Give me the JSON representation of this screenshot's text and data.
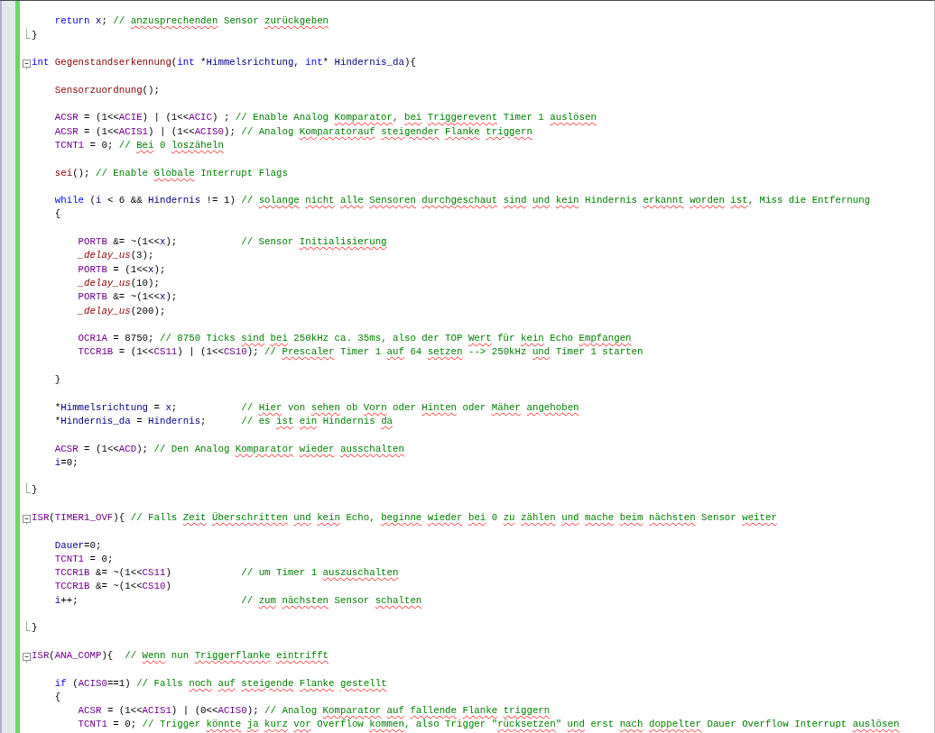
{
  "editor": {
    "lines": [
      {
        "kind": "body"
      },
      {
        "kind": "body",
        "tokens": [
          {
            "t": "    return",
            "kind": "kw"
          },
          {
            "t": " x",
            "kind": "var"
          },
          {
            "t": "; ",
            "kind": "plain"
          },
          {
            "t": "// ",
            "kind": "cm"
          },
          {
            "t": "anzusprechenden",
            "kind": "typo"
          },
          {
            "t": " Sensor ",
            "kind": "cm"
          },
          {
            "t": "zurückgeben",
            "kind": "typo"
          }
        ]
      },
      {
        "kind": "end",
        "tokens": [
          {
            "t": "}",
            "kind": "plain"
          }
        ]
      },
      {
        "kind": "free"
      },
      {
        "kind": "start",
        "tokens": [
          {
            "t": "int ",
            "kind": "kw"
          },
          {
            "t": "Gegenstandserkennung",
            "kind": "fn"
          },
          {
            "t": "(",
            "kind": "plain"
          },
          {
            "t": "int",
            "kind": "kw"
          },
          {
            "t": " *",
            "kind": "plain"
          },
          {
            "t": "Himmelsrichtung",
            "kind": "var"
          },
          {
            "t": ", ",
            "kind": "plain"
          },
          {
            "t": "int",
            "kind": "kw"
          },
          {
            "t": "* ",
            "kind": "plain"
          },
          {
            "t": "Hindernis_da",
            "kind": "var"
          },
          {
            "t": "){",
            "kind": "plain"
          }
        ]
      },
      {
        "kind": "body"
      },
      {
        "kind": "body",
        "tokens": [
          {
            "t": "    Sensorzuordnung",
            "kind": "fn"
          },
          {
            "t": "();",
            "kind": "plain"
          }
        ]
      },
      {
        "kind": "body"
      },
      {
        "kind": "body",
        "tokens": [
          {
            "t": "    ACSR",
            "kind": "macro"
          },
          {
            "t": " = (1<<",
            "kind": "plain"
          },
          {
            "t": "ACIE",
            "kind": "macro"
          },
          {
            "t": ") | (1<<",
            "kind": "plain"
          },
          {
            "t": "ACIC",
            "kind": "macro"
          },
          {
            "t": ") ; ",
            "kind": "plain"
          },
          {
            "t": "// Enable Analog ",
            "kind": "cm"
          },
          {
            "t": "Komparator",
            "kind": "typo"
          },
          {
            "t": ", ",
            "kind": "cm"
          },
          {
            "t": "bei ",
            "kind": "typo"
          },
          {
            "t": "Triggerevent",
            "kind": "typo"
          },
          {
            "t": " Timer 1 ",
            "kind": "cm"
          },
          {
            "t": "auslösen",
            "kind": "typo"
          }
        ]
      },
      {
        "kind": "body",
        "tokens": [
          {
            "t": "    ACSR",
            "kind": "macro"
          },
          {
            "t": " = (1<<",
            "kind": "plain"
          },
          {
            "t": "ACIS1",
            "kind": "macro"
          },
          {
            "t": ") | (1<<",
            "kind": "plain"
          },
          {
            "t": "ACIS0",
            "kind": "macro"
          },
          {
            "t": "); ",
            "kind": "plain"
          },
          {
            "t": "// Analog ",
            "kind": "cm"
          },
          {
            "t": "Komparatorauf ",
            "kind": "typo"
          },
          {
            "t": "steigender ",
            "kind": "typo"
          },
          {
            "t": "Flanke ",
            "kind": "typo"
          },
          {
            "t": "triggern",
            "kind": "typo"
          }
        ]
      },
      {
        "kind": "body",
        "tokens": [
          {
            "t": "    TCNT1",
            "kind": "macro"
          },
          {
            "t": " = 0; ",
            "kind": "plain"
          },
          {
            "t": "// ",
            "kind": "cm"
          },
          {
            "t": "Bei",
            "kind": "typo"
          },
          {
            "t": " 0 ",
            "kind": "cm"
          },
          {
            "t": "loszäheln",
            "kind": "typo"
          }
        ]
      },
      {
        "kind": "body"
      },
      {
        "kind": "body",
        "tokens": [
          {
            "t": "    sei",
            "kind": "fn"
          },
          {
            "t": "(); ",
            "kind": "plain"
          },
          {
            "t": "// Enable ",
            "kind": "cm"
          },
          {
            "t": "Globale",
            "kind": "typo"
          },
          {
            "t": " Interrupt Flags",
            "kind": "cm"
          }
        ]
      },
      {
        "kind": "body"
      },
      {
        "kind": "body",
        "tokens": [
          {
            "t": "    while",
            "kind": "kw"
          },
          {
            "t": " (",
            "kind": "plain"
          },
          {
            "t": "i",
            "kind": "var"
          },
          {
            "t": " < 6 && ",
            "kind": "plain"
          },
          {
            "t": "Hindernis",
            "kind": "var"
          },
          {
            "t": " != 1) ",
            "kind": "plain"
          },
          {
            "t": "// ",
            "kind": "cm"
          },
          {
            "t": "solange ",
            "kind": "typo"
          },
          {
            "t": "nicht ",
            "kind": "typo"
          },
          {
            "t": "alle ",
            "kind": "typo"
          },
          {
            "t": "Sensoren ",
            "kind": "typo"
          },
          {
            "t": "durchgeschaut ",
            "kind": "typo"
          },
          {
            "t": "sind ",
            "kind": "typo"
          },
          {
            "t": "und ",
            "kind": "typo"
          },
          {
            "t": "kein",
            "kind": "typo"
          },
          {
            "t": " Hindernis ",
            "kind": "cm"
          },
          {
            "t": "erkannt ",
            "kind": "typo"
          },
          {
            "t": "worden ",
            "kind": "typo"
          },
          {
            "t": "ist",
            "kind": "typo"
          },
          {
            "t": ", Miss die Entfernung",
            "kind": "cm"
          }
        ]
      },
      {
        "kind": "body",
        "tokens": [
          {
            "t": "    {",
            "kind": "plain"
          }
        ]
      },
      {
        "kind": "body"
      },
      {
        "kind": "body",
        "tokens": [
          {
            "t": "        PORTB",
            "kind": "macro"
          },
          {
            "t": " &= ~(1<<",
            "kind": "plain"
          },
          {
            "t": "x",
            "kind": "var"
          },
          {
            "t": ");           ",
            "kind": "plain"
          },
          {
            "t": "// Sensor ",
            "kind": "cm"
          },
          {
            "t": "Initialisierung",
            "kind": "typo"
          }
        ]
      },
      {
        "kind": "body",
        "tokens": [
          {
            "t": "        _delay_us",
            "kind": "fni"
          },
          {
            "t": "(3);",
            "kind": "plain"
          }
        ]
      },
      {
        "kind": "body",
        "tokens": [
          {
            "t": "        PORTB",
            "kind": "macro"
          },
          {
            "t": " = (1<<",
            "kind": "plain"
          },
          {
            "t": "x",
            "kind": "var"
          },
          {
            "t": ");",
            "kind": "plain"
          }
        ]
      },
      {
        "kind": "body",
        "tokens": [
          {
            "t": "        _delay_us",
            "kind": "fni"
          },
          {
            "t": "(10);",
            "kind": "plain"
          }
        ]
      },
      {
        "kind": "body",
        "tokens": [
          {
            "t": "        PORTB",
            "kind": "macro"
          },
          {
            "t": " &= ~(1<<",
            "kind": "plain"
          },
          {
            "t": "x",
            "kind": "var"
          },
          {
            "t": ");",
            "kind": "plain"
          }
        ]
      },
      {
        "kind": "body",
        "tokens": [
          {
            "t": "        _delay_us",
            "kind": "fni"
          },
          {
            "t": "(200);",
            "kind": "plain"
          }
        ]
      },
      {
        "kind": "body"
      },
      {
        "kind": "body",
        "tokens": [
          {
            "t": "        OCR1A",
            "kind": "macro"
          },
          {
            "t": " = 8750; ",
            "kind": "plain"
          },
          {
            "t": "// 8750 Ticks ",
            "kind": "cm"
          },
          {
            "t": "sind ",
            "kind": "typo"
          },
          {
            "t": "bei",
            "kind": "typo"
          },
          {
            "t": " 250kHz ca. 35ms, also der TOP ",
            "kind": "cm"
          },
          {
            "t": "Wert",
            "kind": "typo"
          },
          {
            "t": " für ",
            "kind": "cm"
          },
          {
            "t": "kein",
            "kind": "typo"
          },
          {
            "t": " Echo ",
            "kind": "cm"
          },
          {
            "t": "Empfangen",
            "kind": "typo"
          }
        ]
      },
      {
        "kind": "body",
        "tokens": [
          {
            "t": "        TCCR1B",
            "kind": "macro"
          },
          {
            "t": " = (1<<",
            "kind": "plain"
          },
          {
            "t": "CS11",
            "kind": "macro"
          },
          {
            "t": ") | (1<<",
            "kind": "plain"
          },
          {
            "t": "CS10",
            "kind": "macro"
          },
          {
            "t": "); ",
            "kind": "plain"
          },
          {
            "t": "// ",
            "kind": "cm"
          },
          {
            "t": "Prescaler",
            "kind": "typo"
          },
          {
            "t": " Timer 1 ",
            "kind": "cm"
          },
          {
            "t": "auf",
            "kind": "typo"
          },
          {
            "t": " 64 ",
            "kind": "cm"
          },
          {
            "t": "setzen",
            "kind": "typo"
          },
          {
            "t": " --> 250kHz ",
            "kind": "cm"
          },
          {
            "t": "und",
            "kind": "typo"
          },
          {
            "t": " Timer 1 starten",
            "kind": "cm"
          }
        ]
      },
      {
        "kind": "body"
      },
      {
        "kind": "body",
        "tokens": [
          {
            "t": "    }",
            "kind": "plain"
          }
        ]
      },
      {
        "kind": "body"
      },
      {
        "kind": "body",
        "tokens": [
          {
            "t": "    *",
            "kind": "plain"
          },
          {
            "t": "Himmelsrichtung",
            "kind": "var"
          },
          {
            "t": " = ",
            "kind": "plain"
          },
          {
            "t": "x",
            "kind": "var"
          },
          {
            "t": ";           ",
            "kind": "plain"
          },
          {
            "t": "// ",
            "kind": "cm"
          },
          {
            "t": "Hier",
            "kind": "typo"
          },
          {
            "t": " von ",
            "kind": "cm"
          },
          {
            "t": "sehen",
            "kind": "typo"
          },
          {
            "t": " ob ",
            "kind": "cm"
          },
          {
            "t": "Vorn",
            "kind": "typo"
          },
          {
            "t": " oder ",
            "kind": "cm"
          },
          {
            "t": "Hinten",
            "kind": "typo"
          },
          {
            "t": " oder ",
            "kind": "cm"
          },
          {
            "t": "Mäher ",
            "kind": "typo"
          },
          {
            "t": "angehoben",
            "kind": "typo"
          }
        ]
      },
      {
        "kind": "body",
        "tokens": [
          {
            "t": "    *",
            "kind": "plain"
          },
          {
            "t": "Hindernis_da",
            "kind": "var"
          },
          {
            "t": " = ",
            "kind": "plain"
          },
          {
            "t": "Hindernis",
            "kind": "var"
          },
          {
            "t": ";      ",
            "kind": "plain"
          },
          {
            "t": "// es ",
            "kind": "cm"
          },
          {
            "t": "ist ",
            "kind": "typo"
          },
          {
            "t": "ein",
            "kind": "typo"
          },
          {
            "t": " Hindernis ",
            "kind": "cm"
          },
          {
            "t": "da",
            "kind": "typo"
          }
        ]
      },
      {
        "kind": "body"
      },
      {
        "kind": "body",
        "tokens": [
          {
            "t": "    ACSR",
            "kind": "macro"
          },
          {
            "t": " = (1<<",
            "kind": "plain"
          },
          {
            "t": "ACD",
            "kind": "macro"
          },
          {
            "t": "); ",
            "kind": "plain"
          },
          {
            "t": "// Den Analog ",
            "kind": "cm"
          },
          {
            "t": "Komparator ",
            "kind": "typo"
          },
          {
            "t": "wieder ",
            "kind": "typo"
          },
          {
            "t": "ausschalten",
            "kind": "typo"
          }
        ]
      },
      {
        "kind": "body",
        "tokens": [
          {
            "t": "    i",
            "kind": "var"
          },
          {
            "t": "=0;",
            "kind": "plain"
          }
        ]
      },
      {
        "kind": "body"
      },
      {
        "kind": "end",
        "tokens": [
          {
            "t": "}",
            "kind": "plain"
          }
        ]
      },
      {
        "kind": "free"
      },
      {
        "kind": "start",
        "tokens": [
          {
            "t": "ISR",
            "kind": "macro"
          },
          {
            "t": "(",
            "kind": "plain"
          },
          {
            "t": "TIMER1_OVF",
            "kind": "macro"
          },
          {
            "t": "){ ",
            "kind": "plain"
          },
          {
            "t": "// Falls ",
            "kind": "cm"
          },
          {
            "t": "Zeit ",
            "kind": "typo"
          },
          {
            "t": "Überschritten ",
            "kind": "typo"
          },
          {
            "t": "und ",
            "kind": "typo"
          },
          {
            "t": "kein",
            "kind": "typo"
          },
          {
            "t": " Echo, ",
            "kind": "cm"
          },
          {
            "t": "beginne ",
            "kind": "typo"
          },
          {
            "t": "wieder ",
            "kind": "typo"
          },
          {
            "t": "bei",
            "kind": "typo"
          },
          {
            "t": " 0 ",
            "kind": "cm"
          },
          {
            "t": "zu ",
            "kind": "typo"
          },
          {
            "t": "zählen ",
            "kind": "typo"
          },
          {
            "t": "und ",
            "kind": "typo"
          },
          {
            "t": "mache ",
            "kind": "typo"
          },
          {
            "t": "beim ",
            "kind": "typo"
          },
          {
            "t": "nächsten",
            "kind": "typo"
          },
          {
            "t": " Sensor ",
            "kind": "cm"
          },
          {
            "t": "weiter",
            "kind": "typo"
          }
        ]
      },
      {
        "kind": "body"
      },
      {
        "kind": "body",
        "tokens": [
          {
            "t": "    Dauer",
            "kind": "var"
          },
          {
            "t": "=0;",
            "kind": "plain"
          }
        ]
      },
      {
        "kind": "body",
        "tokens": [
          {
            "t": "    TCNT1",
            "kind": "macro"
          },
          {
            "t": " = 0;",
            "kind": "plain"
          }
        ]
      },
      {
        "kind": "body",
        "tokens": [
          {
            "t": "    TCCR1B",
            "kind": "macro"
          },
          {
            "t": " &= ~(1<<",
            "kind": "plain"
          },
          {
            "t": "CS11",
            "kind": "macro"
          },
          {
            "t": ")            ",
            "kind": "plain"
          },
          {
            "t": "// um Timer 1 ",
            "kind": "cm"
          },
          {
            "t": "auszuschalten",
            "kind": "typo"
          }
        ]
      },
      {
        "kind": "body",
        "tokens": [
          {
            "t": "    TCCR1B",
            "kind": "macro"
          },
          {
            "t": " &= ~(1<<",
            "kind": "plain"
          },
          {
            "t": "CS10",
            "kind": "macro"
          },
          {
            "t": ")",
            "kind": "plain"
          }
        ]
      },
      {
        "kind": "body",
        "tokens": [
          {
            "t": "    i",
            "kind": "var"
          },
          {
            "t": "++;                            ",
            "kind": "plain"
          },
          {
            "t": "// ",
            "kind": "cm"
          },
          {
            "t": "zum ",
            "kind": "typo"
          },
          {
            "t": "nächsten",
            "kind": "typo"
          },
          {
            "t": " Sensor ",
            "kind": "cm"
          },
          {
            "t": "schalten",
            "kind": "typo"
          }
        ]
      },
      {
        "kind": "body"
      },
      {
        "kind": "end",
        "tokens": [
          {
            "t": "}",
            "kind": "plain"
          }
        ]
      },
      {
        "kind": "free"
      },
      {
        "kind": "start",
        "tokens": [
          {
            "t": "ISR",
            "kind": "macro"
          },
          {
            "t": "(",
            "kind": "plain"
          },
          {
            "t": "ANA_COMP",
            "kind": "macro"
          },
          {
            "t": "){  ",
            "kind": "plain"
          },
          {
            "t": "// ",
            "kind": "cm"
          },
          {
            "t": "Wenn",
            "kind": "typo"
          },
          {
            "t": " nun ",
            "kind": "cm"
          },
          {
            "t": "Triggerflanke ",
            "kind": "typo"
          },
          {
            "t": "eintrifft",
            "kind": "typo"
          }
        ]
      },
      {
        "kind": "body"
      },
      {
        "kind": "body",
        "tokens": [
          {
            "t": "    if",
            "kind": "kw"
          },
          {
            "t": " (",
            "kind": "plain"
          },
          {
            "t": "ACIS0",
            "kind": "macro"
          },
          {
            "t": "==1) ",
            "kind": "plain"
          },
          {
            "t": "// Falls ",
            "kind": "cm"
          },
          {
            "t": "noch ",
            "kind": "typo"
          },
          {
            "t": "auf ",
            "kind": "typo"
          },
          {
            "t": "steigende ",
            "kind": "typo"
          },
          {
            "t": "Flanke ",
            "kind": "typo"
          },
          {
            "t": "gestellt",
            "kind": "typo"
          }
        ]
      },
      {
        "kind": "body",
        "tokens": [
          {
            "t": "    {",
            "kind": "plain"
          }
        ]
      },
      {
        "kind": "body",
        "tokens": [
          {
            "t": "        ACSR",
            "kind": "macro"
          },
          {
            "t": " = (1<<",
            "kind": "plain"
          },
          {
            "t": "ACIS1",
            "kind": "macro"
          },
          {
            "t": ") | (0<<",
            "kind": "plain"
          },
          {
            "t": "ACIS0",
            "kind": "macro"
          },
          {
            "t": "); ",
            "kind": "plain"
          },
          {
            "t": "// Analog ",
            "kind": "cm"
          },
          {
            "t": "Komparator ",
            "kind": "typo"
          },
          {
            "t": "auf ",
            "kind": "typo"
          },
          {
            "t": "fallende ",
            "kind": "typo"
          },
          {
            "t": "Flanke ",
            "kind": "typo"
          },
          {
            "t": "triggern",
            "kind": "typo"
          }
        ]
      },
      {
        "kind": "body",
        "tokens": [
          {
            "t": "        TCNT1",
            "kind": "macro"
          },
          {
            "t": " = 0; ",
            "kind": "plain"
          },
          {
            "t": "// Trigger ",
            "kind": "cm"
          },
          {
            "t": "könnte ",
            "kind": "typo"
          },
          {
            "t": "ja ",
            "kind": "typo"
          },
          {
            "t": "kurz ",
            "kind": "typo"
          },
          {
            "t": "vor",
            "kind": "typo"
          },
          {
            "t": " Overflow ",
            "kind": "cm"
          },
          {
            "t": "kommen",
            "kind": "typo"
          },
          {
            "t": ", also Trigger \"",
            "kind": "cm"
          },
          {
            "t": "rücksetzen",
            "kind": "typo"
          },
          {
            "t": "\" ",
            "kind": "cm"
          },
          {
            "t": "und",
            "kind": "typo"
          },
          {
            "t": " erst ",
            "kind": "cm"
          },
          {
            "t": "nach ",
            "kind": "typo"
          },
          {
            "t": "doppelter",
            "kind": "typo"
          },
          {
            "t": " Dauer Overflow Interrupt ",
            "kind": "cm"
          },
          {
            "t": "auslösen",
            "kind": "typo"
          }
        ]
      }
    ]
  }
}
